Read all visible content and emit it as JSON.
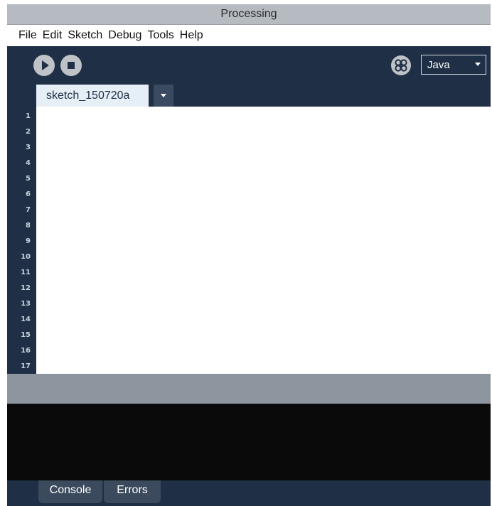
{
  "window": {
    "title": "Processing"
  },
  "menubar": {
    "items": [
      "File",
      "Edit",
      "Sketch",
      "Debug",
      "Tools",
      "Help"
    ]
  },
  "toolbar": {
    "run_icon": "play-icon",
    "stop_icon": "stop-icon",
    "debug_icon": "butterfly-debugger-icon",
    "mode_value": "Java"
  },
  "tabs": {
    "active": "sketch_150720a"
  },
  "editor": {
    "line_numbers": [
      "1",
      "2",
      "3",
      "4",
      "5",
      "6",
      "7",
      "8",
      "9",
      "10",
      "11",
      "12",
      "13",
      "14",
      "15",
      "16",
      "17"
    ]
  },
  "footer": {
    "console_label": "Console",
    "errors_label": "Errors"
  },
  "colors": {
    "chrome": "#1e2f46",
    "titlebar": "#b5bbc1",
    "console_bg": "#0a0a0a",
    "divider": "#8d969f"
  }
}
